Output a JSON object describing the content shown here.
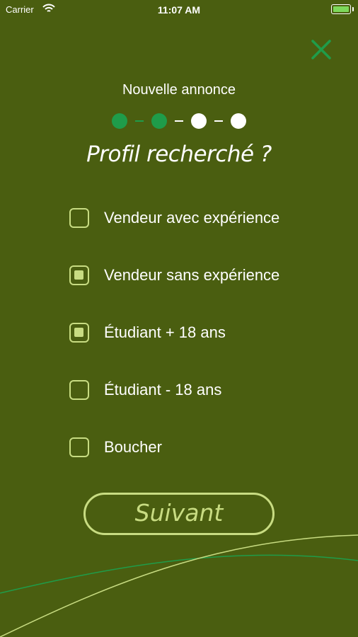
{
  "status_bar": {
    "carrier": "Carrier",
    "time": "11:07 AM"
  },
  "header": {
    "title": "Nouvelle annonce",
    "steps_total": 4,
    "steps_completed": 2
  },
  "question": "Profil recherché ?",
  "options": [
    {
      "label": "Vendeur avec expérience",
      "checked": false
    },
    {
      "label": "Vendeur sans expérience",
      "checked": true
    },
    {
      "label": "Étudiant + 18 ans",
      "checked": true
    },
    {
      "label": "Étudiant - 18 ans",
      "checked": false
    },
    {
      "label": "Boucher",
      "checked": false
    }
  ],
  "next_button_label": "Suivant",
  "colors": {
    "background": "#4a5e10",
    "accent_green": "#1f9c4a",
    "lime": "#c8dc82",
    "text": "#ffffff"
  },
  "icons": [
    "wifi-icon",
    "battery-icon",
    "close-icon",
    "checkbox-icon"
  ]
}
